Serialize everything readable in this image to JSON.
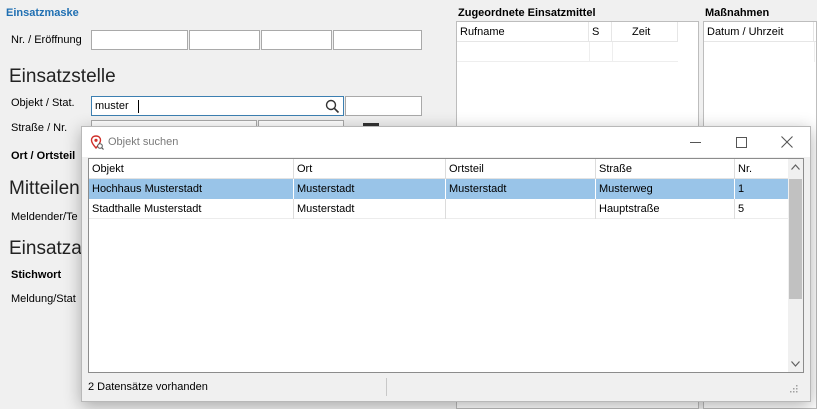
{
  "form": {
    "title": "Einsatzmaske",
    "nr_label": "Nr. / Eröffnung",
    "section_einsatzstelle": "Einsatzstelle",
    "objekt_label": "Objekt / Stat.",
    "objekt_value": "muster",
    "strasse_label": "Straße / Nr.",
    "ortsteil_label": "Ort / Ortsteil",
    "section_mitteilende": "Mitteilen",
    "melder_label": "Meldender/Te",
    "section_einsatzart": "Einsatza",
    "stichwort_label": "Stichwort",
    "meldung_label": "Meldung/Stat"
  },
  "einsatzmittel": {
    "title": "Zugeordnete Einsatzmittel",
    "columns": [
      "Rufname",
      "S",
      "Zeit"
    ]
  },
  "massnahmen": {
    "title": "Maßnahmen",
    "columns": [
      "Datum / Uhrzeit"
    ]
  },
  "dialog": {
    "title": "Objekt suchen",
    "columns": [
      "Objekt",
      "Ort",
      "Ortsteil",
      "Straße",
      "Nr."
    ],
    "rows": [
      {
        "objekt": "Hochhaus Musterstadt",
        "ort": "Musterstadt",
        "ortsteil": "Musterstadt",
        "strasse": "Musterweg",
        "nr": "1"
      },
      {
        "objekt": "Stadthalle Musterstadt",
        "ort": "Musterstadt",
        "ortsteil": "",
        "strasse": "Hauptstraße",
        "nr": "5"
      }
    ],
    "status": "2 Datensätze vorhanden",
    "icons": {
      "title": "map-pin-search-icon",
      "minimize": "minimize-icon",
      "maximize": "maximize-icon",
      "close": "close-icon"
    }
  }
}
